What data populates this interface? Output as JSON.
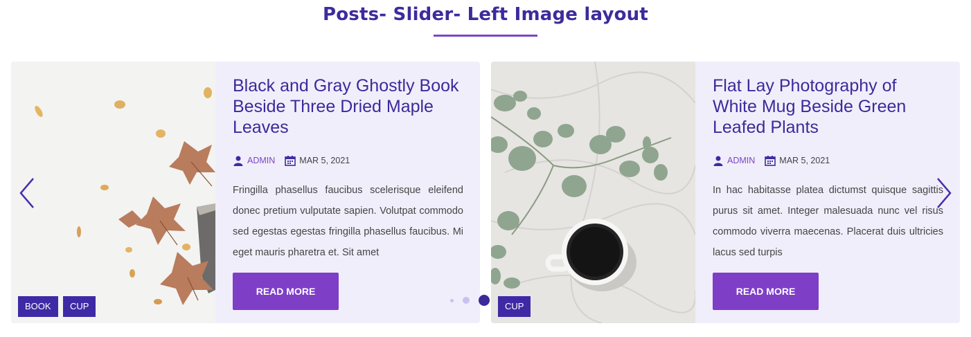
{
  "section": {
    "title": "Posts- Slider- Left Image layout",
    "accent_color": "#3f2a9c",
    "underline_color": "#7a45c7"
  },
  "slider": {
    "prev_icon": "chevron-left-icon",
    "next_icon": "chevron-right-icon",
    "dots_count": 3,
    "active_dot": 3
  },
  "posts": [
    {
      "title": "Black and Gray Ghostly Book Beside Three Dried Maple Leaves",
      "author": "ADMIN",
      "date": "MAR 5, 2021",
      "excerpt": "Fringilla phasellus faucibus scelerisque eleifend donec pretium vulputate sapien. Volutpat commodo sed egestas egestas fringilla phasellus faucibus. Mi eget mauris pharetra et. Sit amet",
      "read_more": "READ MORE",
      "tags": [
        "BOOK",
        "CUP"
      ],
      "image": "autumn-leaves-and-book-photo"
    },
    {
      "title": "Flat Lay Photography of White Mug Beside Green Leafed Plants",
      "author": "ADMIN",
      "date": "MAR 5, 2021",
      "excerpt": "In hac habitasse platea dictumst quisque sagittis purus sit amet. Integer malesuada nunc vel risus commodo viverra maecenas. Placerat duis ultricies lacus sed turpis",
      "read_more": "READ MORE",
      "tags": [
        "CUP"
      ],
      "image": "coffee-mug-and-eucalyptus-photo"
    }
  ],
  "colors": {
    "card_bg": "#f1eefb",
    "tag_bg": "#3f2aa5",
    "button_bg": "#7e3fc6",
    "title": "#3c2a9a",
    "author": "#7a45c7"
  }
}
